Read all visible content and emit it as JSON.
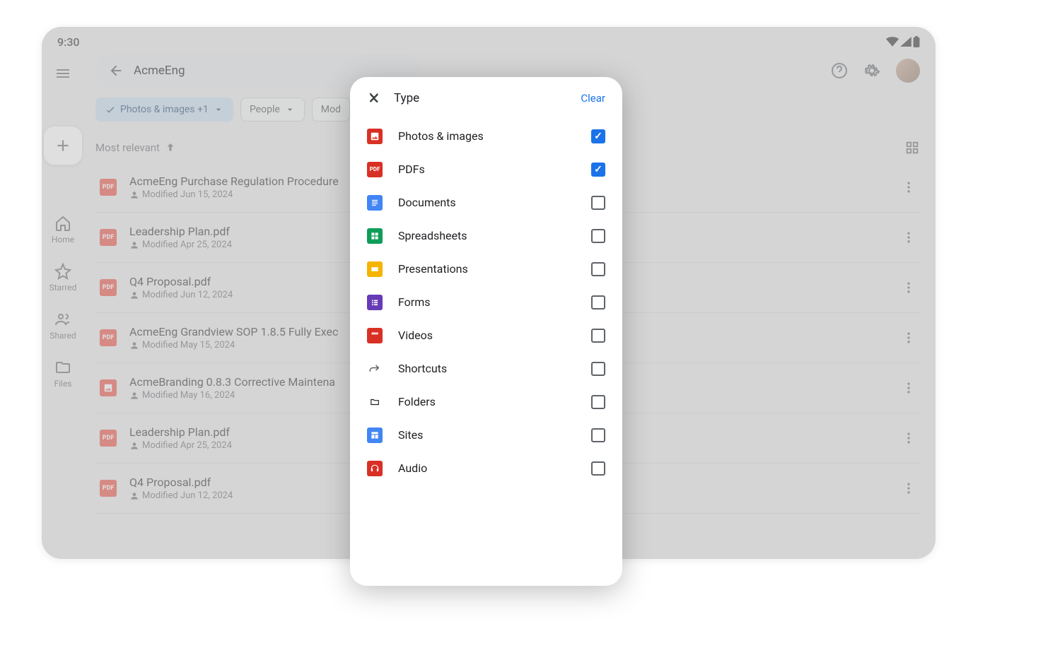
{
  "status": {
    "time": "9:30"
  },
  "search": {
    "value": "AcmeEng"
  },
  "chips": {
    "type": "Photos & images +1",
    "people": "People",
    "modified": "Mod"
  },
  "nav": {
    "home": "Home",
    "starred": "Starred",
    "shared": "Shared",
    "files": "Files"
  },
  "sort": {
    "label": "Most relevant"
  },
  "files": [
    {
      "name": "AcmeEng Purchase Regulation Procedure",
      "meta": "Modified Jun 15, 2024",
      "kind": "pdf"
    },
    {
      "name": "Leadership Plan.pdf",
      "meta": "Modified Apr 25, 2024",
      "kind": "pdf"
    },
    {
      "name": "Q4 Proposal.pdf",
      "meta": "Modified Jun 12, 2024",
      "kind": "pdf"
    },
    {
      "name": "AcmeEng Grandview SOP 1.8.5 Fully Exec",
      "meta": "Modified May 15, 2024",
      "kind": "pdf"
    },
    {
      "name": "AcmeBranding 0.8.3 Corrective Maintena",
      "meta": "Modified May 16, 2024",
      "kind": "img"
    },
    {
      "name": "Leadership Plan.pdf",
      "meta": "Modified Apr 25, 2024",
      "kind": "pdf"
    },
    {
      "name": "Q4 Proposal.pdf",
      "meta": "Modified Jun 12, 2024",
      "kind": "pdf"
    }
  ],
  "popup": {
    "title": "Type",
    "clear": "Clear",
    "types": [
      {
        "label": "Photos & images",
        "icon": "photos",
        "checked": true
      },
      {
        "label": "PDFs",
        "icon": "pdf",
        "checked": true
      },
      {
        "label": "Documents",
        "icon": "docs",
        "checked": false
      },
      {
        "label": "Spreadsheets",
        "icon": "sheets",
        "checked": false
      },
      {
        "label": "Presentations",
        "icon": "slides",
        "checked": false
      },
      {
        "label": "Forms",
        "icon": "forms",
        "checked": false
      },
      {
        "label": "Videos",
        "icon": "videos",
        "checked": false
      },
      {
        "label": "Shortcuts",
        "icon": "shortcuts",
        "checked": false
      },
      {
        "label": "Folders",
        "icon": "folders",
        "checked": false
      },
      {
        "label": "Sites",
        "icon": "sites",
        "checked": false
      },
      {
        "label": "Audio",
        "icon": "audio",
        "checked": false
      }
    ]
  }
}
